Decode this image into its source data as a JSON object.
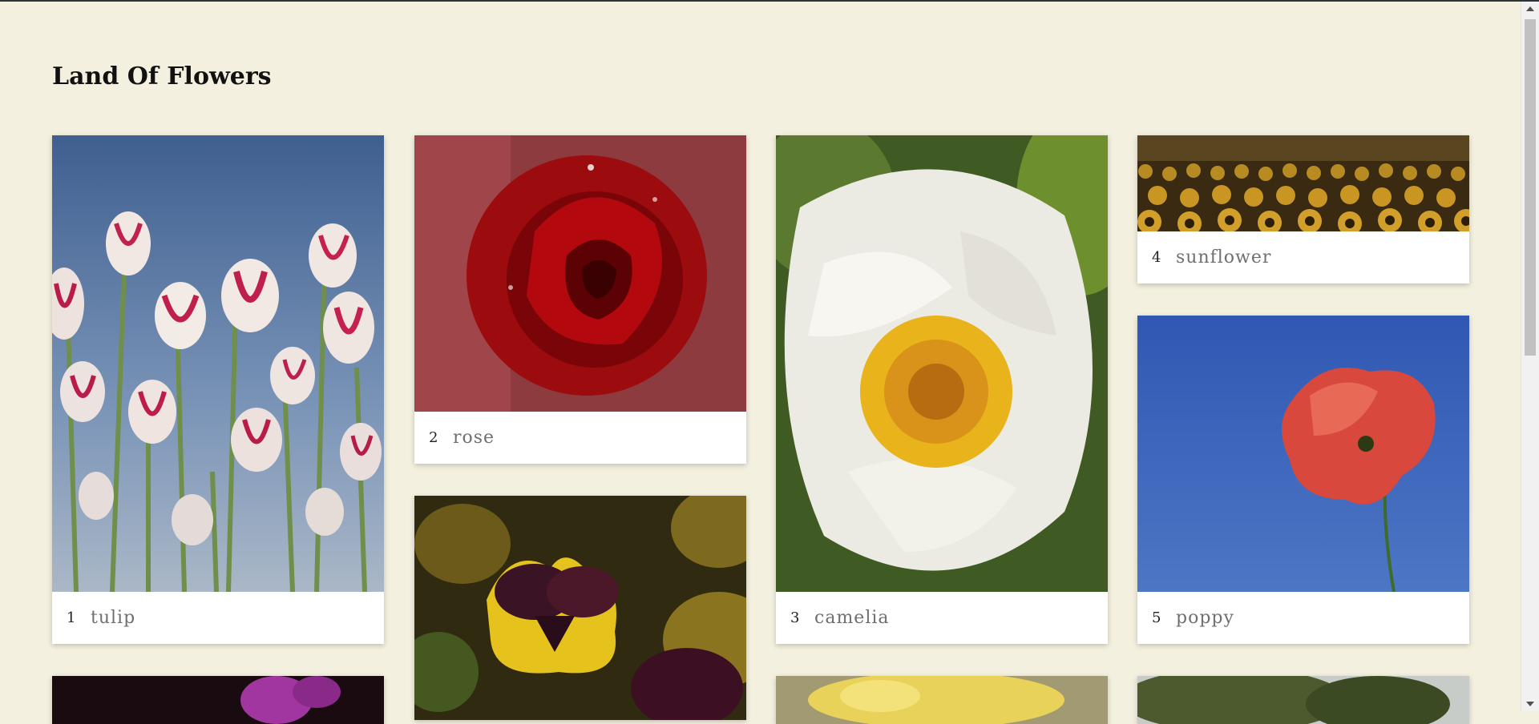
{
  "page": {
    "title": "Land Of Flowers"
  },
  "cards": [
    {
      "num": "1",
      "name": "tulip",
      "image_icon": "tulip-photo"
    },
    {
      "num": "2",
      "name": "rose",
      "image_icon": "rose-photo"
    },
    {
      "num": "3",
      "name": "camelia",
      "image_icon": "camelia-photo"
    },
    {
      "num": "4",
      "name": "sunflower",
      "image_icon": "sunflower-photo"
    },
    {
      "num": "5",
      "name": "poppy",
      "image_icon": "poppy-photo"
    }
  ],
  "partial_images": [
    "pansy-photo",
    "orchid-photo",
    "yellow-flower-photo",
    "tree-photo"
  ],
  "colors": {
    "background": "#f4f0df",
    "card": "#ffffff",
    "caption_text": "#6f6f6f"
  }
}
